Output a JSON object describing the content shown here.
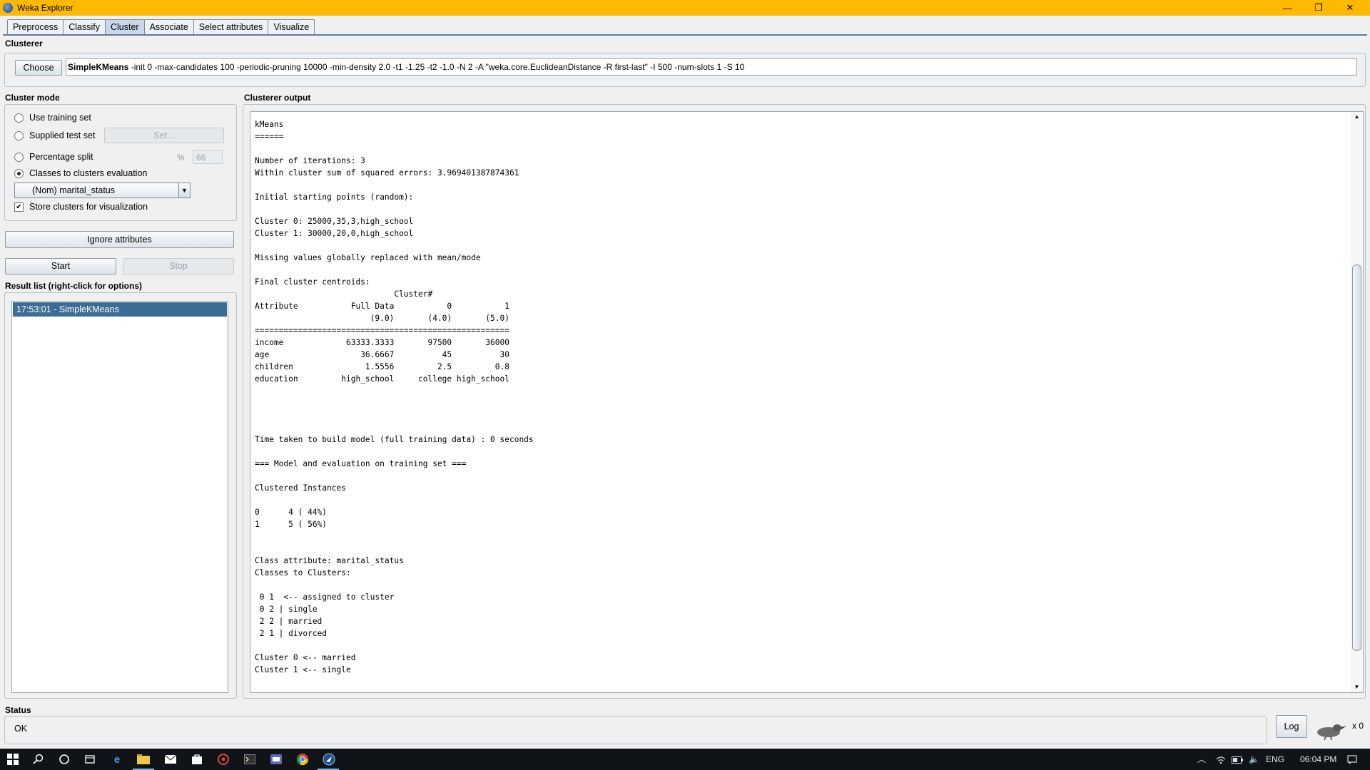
{
  "window": {
    "title": "Weka Explorer",
    "minimize": "—",
    "maximize": "❐",
    "close": "✕"
  },
  "tabs": [
    "Preprocess",
    "Classify",
    "Cluster",
    "Associate",
    "Select attributes",
    "Visualize"
  ],
  "active_tab": "Cluster",
  "clusterer": {
    "section_label": "Clusterer",
    "choose_label": "Choose",
    "name": "SimpleKMeans",
    "options": " -init 0 -max-candidates 100 -periodic-pruning 10000 -min-density 2.0 -t1 -1.25 -t2 -1.0 -N 2 -A \"weka.core.EuclideanDistance -R first-last\" -I 500 -num-slots 1 -S 10"
  },
  "cluster_mode": {
    "section_label": "Cluster mode",
    "use_training_set": "Use training set",
    "supplied_test_set": "Supplied test set",
    "set_button": "Set...",
    "percentage_split": "Percentage split",
    "percent_sign": "%",
    "percent_value": "66",
    "classes_to_clusters": "Classes to clusters evaluation",
    "class_select": "(Nom) marital_status",
    "store_clusters": "Store clusters for visualization",
    "selected_mode": "classes_to_clusters",
    "store_clusters_checked": true
  },
  "ignore_attributes_label": "Ignore attributes",
  "start_label": "Start",
  "stop_label": "Stop",
  "result_list": {
    "label": "Result list (right-click for options)",
    "items": [
      "17:53:01 - SimpleKMeans"
    ]
  },
  "output": {
    "label": "Clusterer output",
    "text": "kMeans\n======\n\nNumber of iterations: 3\nWithin cluster sum of squared errors: 3.969401387874361\n\nInitial starting points (random):\n\nCluster 0: 25000,35,3,high_school\nCluster 1: 30000,20,0,high_school\n\nMissing values globally replaced with mean/mode\n\nFinal cluster centroids:\n                             Cluster#\nAttribute           Full Data           0           1\n                        (9.0)       (4.0)       (5.0)\n=====================================================\nincome             63333.3333       97500       36000\nage                   36.6667          45          30\nchildren               1.5556         2.5         0.8\neducation         high_school     college high_school\n\n\n\n\nTime taken to build model (full training data) : 0 seconds\n\n=== Model and evaluation on training set ===\n\nClustered Instances\n\n0      4 ( 44%)\n1      5 ( 56%)\n\n\nClass attribute: marital_status\nClasses to Clusters:\n\n 0 1  <-- assigned to cluster\n 0 2 | single\n 2 2 | married\n 2 1 | divorced\n\nCluster 0 <-- married\nCluster 1 <-- single"
  },
  "status": {
    "label": "Status",
    "text": "OK",
    "log_label": "Log",
    "count": "x 0"
  },
  "taskbar": {
    "icons": [
      "windows-start",
      "search",
      "cortana",
      "task-view",
      "edge",
      "file-explorer",
      "mail",
      "store",
      "app-red",
      "terminal",
      "app-blue",
      "chrome",
      "weka"
    ],
    "language": "ENG",
    "time": "06:04 PM",
    "colors": {
      "accent": "#ffb900",
      "selection": "#3d6d94"
    }
  }
}
